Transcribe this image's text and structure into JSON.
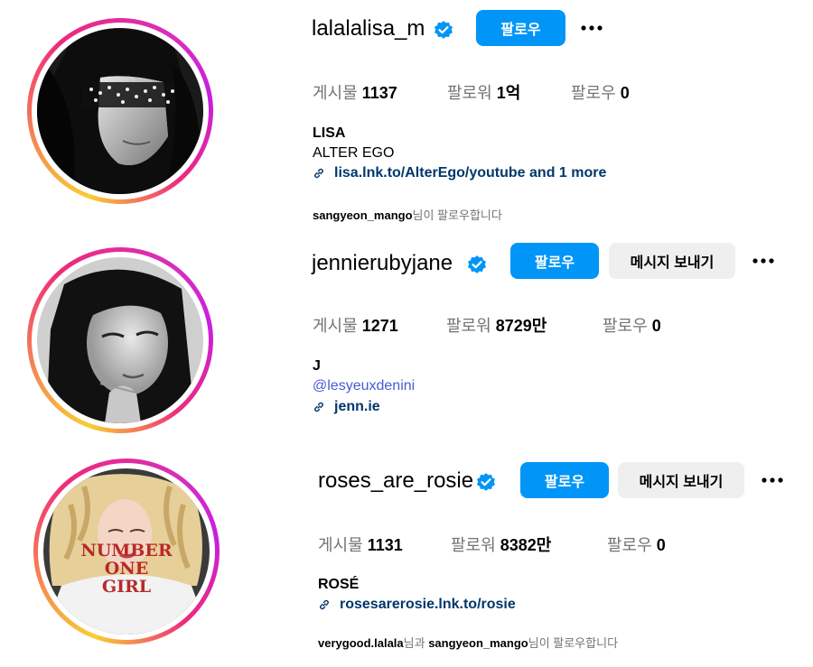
{
  "colors": {
    "follow_button": "#0095f6",
    "message_button": "#efefef",
    "link": "#00376b",
    "mention": "#4a5ad4",
    "muted": "#737373"
  },
  "profiles": [
    {
      "username": "lalalalisa_m",
      "follow_label": "팔로우",
      "stats": {
        "posts_label": "게시물",
        "posts_value": "1137",
        "followers_label": "팔로워",
        "followers_value": "1억",
        "following_label": "팔로우",
        "following_value": "0"
      },
      "full_name": "LISA",
      "bio": "ALTER EGO",
      "link": "lisa.lnk.to/AlterEgo/youtube and 1 more",
      "followed_by_user1": "sangyeon_mango",
      "followed_by_suffix": "님이 팔로우합니다"
    },
    {
      "username": "jennierubyjane",
      "follow_label": "팔로우",
      "message_label": "메시지 보내기",
      "stats": {
        "posts_label": "게시물",
        "posts_value": "1271",
        "followers_label": "팔로워",
        "followers_value": "8729만",
        "following_label": "팔로우",
        "following_value": "0"
      },
      "full_name": "J",
      "mention": "@lesyeuxdenini",
      "link": "jenn.ie"
    },
    {
      "username": "roses_are_rosie",
      "follow_label": "팔로우",
      "message_label": "메시지 보내기",
      "stats": {
        "posts_label": "게시물",
        "posts_value": "1131",
        "followers_label": "팔로워",
        "followers_value": "8382만",
        "following_label": "팔로우",
        "following_value": "0"
      },
      "full_name": "ROSÉ",
      "link": "rosesarerosie.lnk.to/rosie",
      "followed_by_user1": "verygood.lalala",
      "followed_by_mid": "님과 ",
      "followed_by_user2": "sangyeon_mango",
      "followed_by_suffix": "님이 팔로우합니다",
      "shirt_text": [
        "NUMBER",
        "ONE",
        "GIRL"
      ]
    }
  ]
}
